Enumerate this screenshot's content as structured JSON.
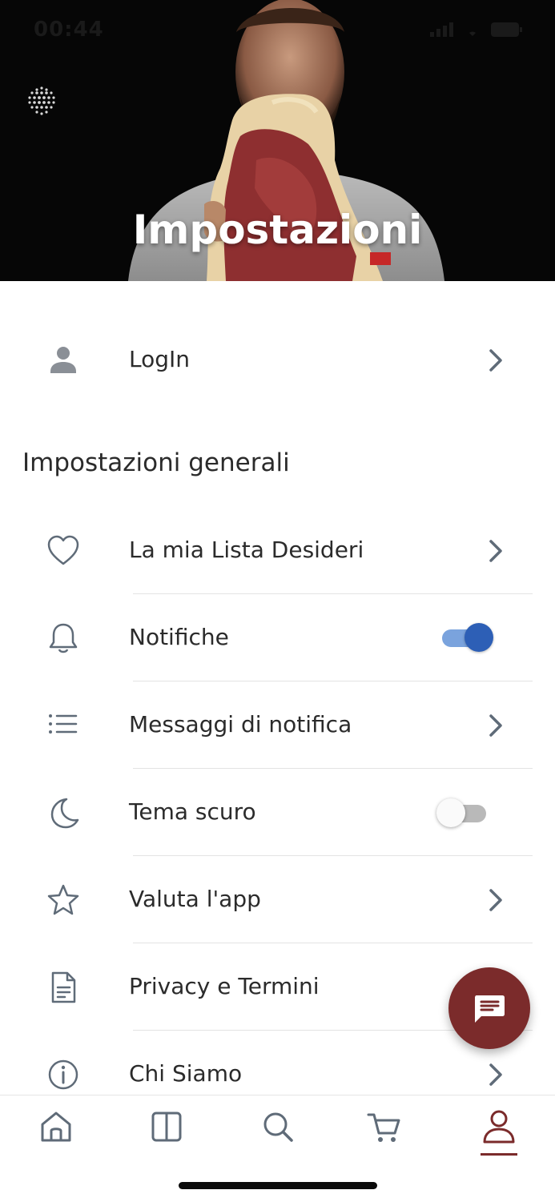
{
  "status_bar": {
    "time": "00:44"
  },
  "header": {
    "title": "Impostazioni"
  },
  "login": {
    "label": "LogIn"
  },
  "section": {
    "title": "Impostazioni generali"
  },
  "menu": {
    "items": [
      {
        "label": "La mia Lista Desideri",
        "icon": "heart-icon"
      },
      {
        "label": "Notifiche",
        "icon": "bell-icon",
        "toggle": true
      },
      {
        "label": "Messaggi di notifica",
        "icon": "list-icon"
      },
      {
        "label": "Tema scuro",
        "icon": "moon-icon",
        "toggle": false
      },
      {
        "label": "Valuta l'app",
        "icon": "star-icon"
      },
      {
        "label": "Privacy e Termini",
        "icon": "document-icon"
      },
      {
        "label": "Chi Siamo",
        "icon": "info-icon"
      }
    ]
  },
  "bottom_nav": {
    "items": [
      "home-icon",
      "catalog-icon",
      "search-icon",
      "cart-icon",
      "profile-icon"
    ],
    "active": "profile-icon"
  },
  "colors": {
    "accent": "#7b2b2b",
    "toggle_on": "#2d5fb6",
    "icon_gray": "#5f6b78"
  }
}
